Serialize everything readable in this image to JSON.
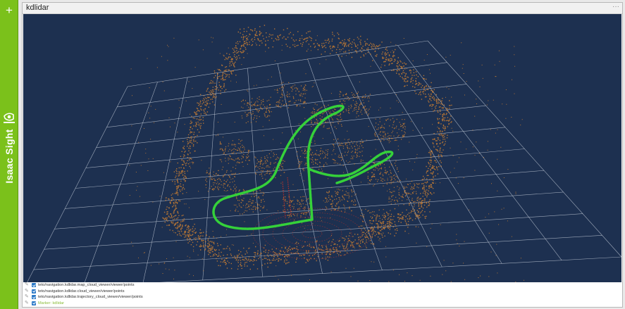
{
  "sidebar": {
    "add_icon": "plus-icon",
    "add_label": "+",
    "logo_icon": "nvidia-logo-icon",
    "brand": "Isaac Sight",
    "color": "#7bc11b"
  },
  "window": {
    "title": "kdlidar",
    "menu_icon": "window-menu-icon",
    "menu_label": "···"
  },
  "viewport": {
    "background": "#1d3050",
    "grid_color": "#c8d0dc",
    "pointcloud_color": "#e48a2c",
    "trajectory_color": "#35d13a",
    "scan_color": "#e03020"
  },
  "layers": [
    {
      "edit_icon": "pencil-icon",
      "checked": true,
      "name": "teto/navigation.kdlidar.map_cloud_viewer/viewer/points"
    },
    {
      "edit_icon": "pencil-icon",
      "checked": true,
      "name": "teto/navigation.kdlidar.cloud_viewer/viewer/points"
    },
    {
      "edit_icon": "pencil-icon",
      "checked": true,
      "name": "teto/navigation.kdlidar.trajectory_cloud_viewer/viewer/points"
    },
    {
      "edit_icon": "pencil-icon",
      "checked": true,
      "name": "Marker: kdlidar"
    }
  ]
}
